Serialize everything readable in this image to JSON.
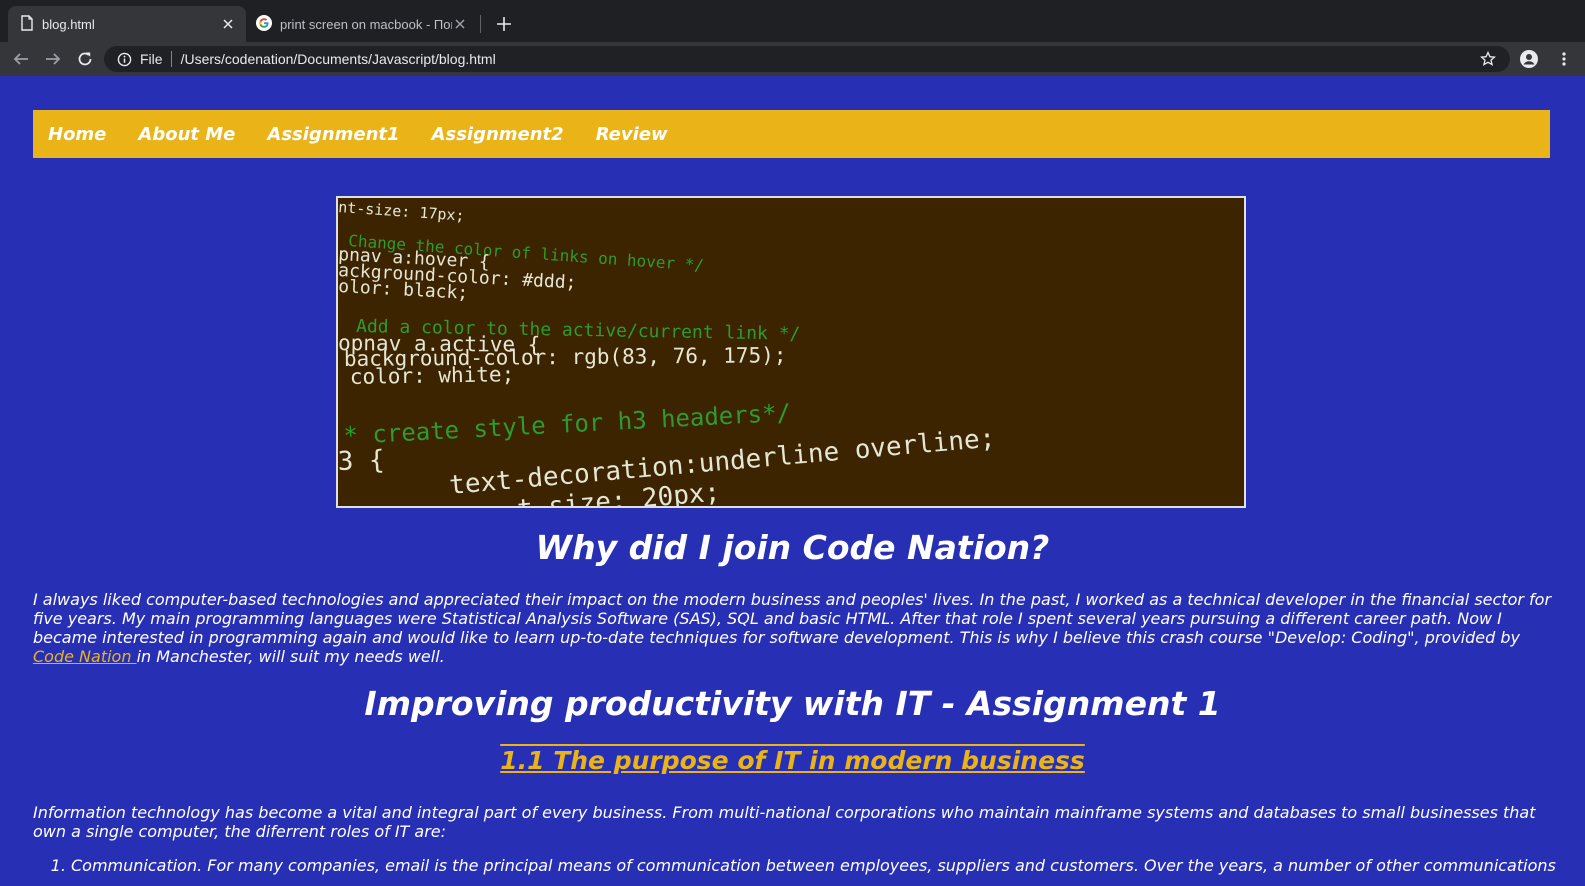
{
  "browser": {
    "tabs": [
      {
        "title": "blog.html",
        "active": true
      },
      {
        "title": "print screen on macbook - Поиск",
        "active": false
      }
    ],
    "address": {
      "scheme": "File",
      "path": "/Users/codenation/Documents/Javascript/blog.html"
    }
  },
  "nav": {
    "items": [
      "Home",
      "About Me",
      "Assignment1",
      "Assignment2",
      "Review"
    ]
  },
  "hero_code": {
    "lines": [
      {
        "text": "nt-size: 17px;",
        "color": "#e6e6d6"
      },
      {
        "text": "Change the color of links on hover */",
        "color": "#2f9b2f"
      },
      {
        "text": "pnav a:hover {",
        "color": "#e6e6d6"
      },
      {
        "text": "ackground-color: #ddd;",
        "color": "#e6e6d6"
      },
      {
        "text": "olor: black;",
        "color": "#e6e6d6"
      },
      {
        "text": "Add a color to the active/current link */",
        "color": "#2f9b2f"
      },
      {
        "text": "opnav a.active {",
        "color": "#e6e6d6"
      },
      {
        "text": "background-color: rgb(83, 76, 175);",
        "color": "#e6e6d6"
      },
      {
        "text": "color: white;",
        "color": "#e6e6d6"
      },
      {
        "text": "* create style for h3 headers*/",
        "color": "#2f9b2f"
      },
      {
        "text": "3 {",
        "color": "#e6e6d6"
      },
      {
        "text": "text-decoration:underline overline;",
        "color": "#e6e6d6"
      },
      {
        "text": "t-size: 20px;",
        "color": "#e6e6d6"
      }
    ]
  },
  "content": {
    "why_heading": "Why did I join Code Nation?",
    "why_text": "I always liked computer-based technologies and appreciated their impact on the modern business and peoples' lives. In the past, I worked as a technical developer in the financial sector for five years. My main programming languages were Statistical Analysis Software (SAS), SQL and basic HTML. After that role I spent several years pursuing a different career path. Now I became interested in programming again and would like to learn up-to-date techniques for software development. This is why I believe this crash course \"Develop: Coding\", provided by",
    "why_link": "Code Nation ",
    "why_tail": "in Manchester, will suit my needs well.",
    "assignment_heading": "Improving productivity with IT - Assignment 1",
    "section_heading": "1.1 The purpose of IT in modern business",
    "intro_text": "Information technology has become a vital and integral part of every business. From multi-national corporations who maintain mainframe systems and databases to small businesses that own a single computer, the diferrent roles of IT are:",
    "list_items": [
      "Communication. For many companies, email is the principal means of communication between employees, suppliers and customers. Over the years, a number of other communications"
    ]
  },
  "colors": {
    "page_bg": "#272fb5",
    "nav_bg": "#eab418",
    "link": "#eab418"
  }
}
